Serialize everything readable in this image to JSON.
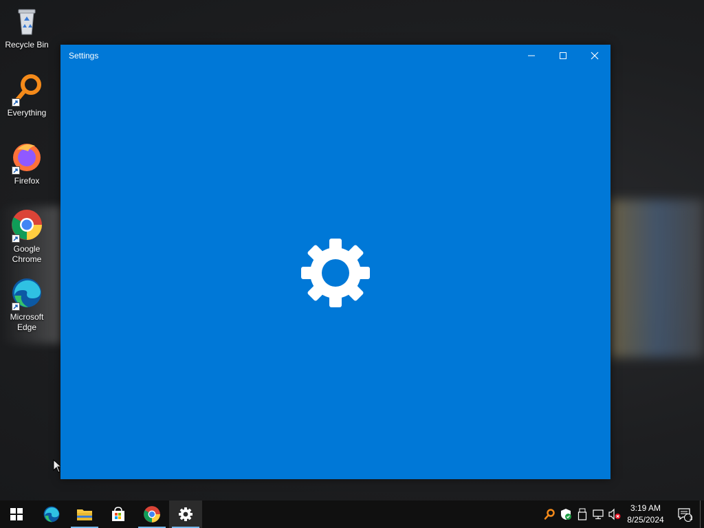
{
  "desktop": {
    "icons": [
      {
        "label": "Recycle Bin",
        "icon": "recycle-bin-icon"
      },
      {
        "label": "Everything",
        "icon": "everything-search-icon"
      },
      {
        "label": "Firefox",
        "icon": "firefox-icon"
      },
      {
        "label": "Google\nChrome",
        "icon": "chrome-icon"
      },
      {
        "label": "Microsoft\nEdge",
        "icon": "edge-icon"
      }
    ]
  },
  "window": {
    "title": "Settings",
    "background": "#0078d7",
    "splash_icon": "gear-icon"
  },
  "taskbar": {
    "apps": [
      {
        "name": "Start",
        "icon": "windows-logo-icon"
      },
      {
        "name": "Microsoft Edge",
        "icon": "edge-icon"
      },
      {
        "name": "File Explorer",
        "icon": "folder-icon"
      },
      {
        "name": "Microsoft Store",
        "icon": "store-icon"
      },
      {
        "name": "Google Chrome",
        "icon": "chrome-icon"
      },
      {
        "name": "Settings",
        "icon": "gear-icon",
        "active": true
      }
    ],
    "tray": [
      "everything-search-icon",
      "security-shield-icon",
      "usb-drive-icon",
      "network-icon",
      "volume-muted-icon"
    ],
    "time": "3:19 AM",
    "date": "8/25/2024",
    "notification_count": "1"
  }
}
